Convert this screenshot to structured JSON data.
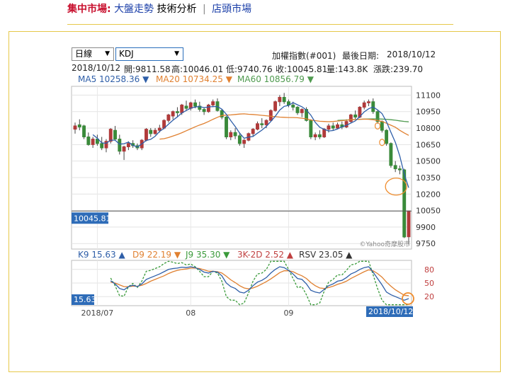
{
  "header": {
    "section": "集中市場:",
    "link1": "大盤走勢",
    "link2": "技術分析",
    "separator": "|",
    "link3": "店頭市場"
  },
  "controls": {
    "period": "日線",
    "indicator": "KDJ",
    "index_name": "加權指數(#001)",
    "last_date_label": "最後日期:",
    "last_date": "2018/10/12"
  },
  "quote": {
    "date": "2018/10/12",
    "open": "開:9811.58",
    "high": "高:10046.01",
    "low": "低:9740.76",
    "close": "收:10045.81",
    "volume": "量:143.8K",
    "change": "漲跌:239.70"
  },
  "ma_labels": {
    "ma5": "MA5 10258.36 ▼",
    "ma20": "MA20 10734.25 ▼",
    "ma60": "MA60 10856.79 ▼"
  },
  "kdj_labels": {
    "k": "K9 15.63 ▲",
    "d": "D9 22.19 ▼",
    "j": "J9 35.30 ▼",
    "diff": "3K-2D 2.52 ▲",
    "rsv": "RSV 23.05 ▲"
  },
  "colors": {
    "up": "#b03a3a",
    "down": "#3a8a3a",
    "ma5": "#2e5ea8",
    "ma20": "#e08030",
    "ma60": "#4f9a4f",
    "k": "#2e5ea8",
    "d": "#e08030",
    "j": "#3a9a3a",
    "badge": "#2e6cb8",
    "header_red": "#c8102e",
    "header_blue": "#1a3ea8",
    "highlight": "#f08c2c"
  },
  "chart_data": {
    "type": "candlestick",
    "price_axis": {
      "ticks": [
        11100,
        10950,
        10800,
        10650,
        10500,
        10350,
        10200,
        10050,
        9900,
        9750
      ],
      "range": [
        9700,
        11180
      ]
    },
    "kdj_axis": {
      "ticks": [
        80,
        50,
        20
      ],
      "range": [
        0,
        100
      ]
    },
    "x_ticks": [
      {
        "index": 5,
        "label": "2018/07"
      },
      {
        "index": 26,
        "label": "08"
      },
      {
        "index": 48,
        "label": "09"
      }
    ],
    "last_price_label": "10045.81",
    "last_k_label": "15.63",
    "last_date_label": "2018/10/12",
    "watermark": "©Yahoo奇摩股市",
    "ohlc": [
      [
        10790,
        10850,
        10750,
        10820
      ],
      [
        10830,
        10880,
        10780,
        10810
      ],
      [
        10820,
        10830,
        10700,
        10720
      ],
      [
        10720,
        10760,
        10640,
        10650
      ],
      [
        10650,
        10720,
        10620,
        10700
      ],
      [
        10700,
        10740,
        10640,
        10660
      ],
      [
        10660,
        10720,
        10600,
        10620
      ],
      [
        10620,
        10700,
        10580,
        10680
      ],
      [
        10680,
        10800,
        10660,
        10790
      ],
      [
        10780,
        10820,
        10690,
        10700
      ],
      [
        10700,
        10740,
        10560,
        10590
      ],
      [
        10590,
        10640,
        10510,
        10630
      ],
      [
        10630,
        10680,
        10600,
        10660
      ],
      [
        10660,
        10690,
        10620,
        10640
      ],
      [
        10640,
        10660,
        10600,
        10620
      ],
      [
        10620,
        10700,
        10600,
        10690
      ],
      [
        10690,
        10800,
        10680,
        10790
      ],
      [
        10780,
        10800,
        10720,
        10750
      ],
      [
        10750,
        10800,
        10740,
        10780
      ],
      [
        10780,
        10830,
        10760,
        10800
      ],
      [
        10800,
        10880,
        10790,
        10870
      ],
      [
        10870,
        10930,
        10850,
        10920
      ],
      [
        10910,
        10960,
        10880,
        10950
      ],
      [
        10950,
        10990,
        10900,
        10940
      ],
      [
        10940,
        11020,
        10920,
        11010
      ],
      [
        11000,
        11050,
        10960,
        10980
      ],
      [
        10980,
        11040,
        10960,
        11030
      ],
      [
        11030,
        11060,
        10980,
        11000
      ],
      [
        11000,
        11040,
        10950,
        10970
      ],
      [
        10970,
        10990,
        10920,
        10950
      ],
      [
        10950,
        11020,
        10940,
        11010
      ],
      [
        11010,
        11060,
        10990,
        11040
      ],
      [
        11040,
        11070,
        10950,
        10960
      ],
      [
        10960,
        10970,
        10880,
        10900
      ],
      [
        10900,
        10910,
        10700,
        10720
      ],
      [
        10720,
        10780,
        10690,
        10760
      ],
      [
        10760,
        10800,
        10700,
        10730
      ],
      [
        10730,
        10760,
        10640,
        10660
      ],
      [
        10660,
        10700,
        10620,
        10690
      ],
      [
        10690,
        10760,
        10680,
        10750
      ],
      [
        10750,
        10800,
        10720,
        10790
      ],
      [
        10790,
        10860,
        10780,
        10840
      ],
      [
        10840,
        10890,
        10800,
        10830
      ],
      [
        10830,
        10880,
        10800,
        10870
      ],
      [
        10870,
        10970,
        10860,
        10960
      ],
      [
        10960,
        11050,
        10950,
        11040
      ],
      [
        11040,
        11100,
        11000,
        11080
      ],
      [
        11080,
        11120,
        11020,
        11040
      ],
      [
        11040,
        11060,
        10990,
        11010
      ],
      [
        11010,
        11040,
        10960,
        10990
      ],
      [
        10990,
        11000,
        10920,
        10940
      ],
      [
        10940,
        10980,
        10900,
        10970
      ],
      [
        10970,
        10990,
        10860,
        10870
      ],
      [
        10870,
        10880,
        10700,
        10720
      ],
      [
        10720,
        10760,
        10690,
        10740
      ],
      [
        10740,
        10780,
        10700,
        10720
      ],
      [
        10720,
        10800,
        10710,
        10790
      ],
      [
        10790,
        10840,
        10760,
        10820
      ],
      [
        10820,
        10850,
        10780,
        10800
      ],
      [
        10800,
        10850,
        10790,
        10830
      ],
      [
        10830,
        10860,
        10790,
        10810
      ],
      [
        10810,
        10880,
        10800,
        10860
      ],
      [
        10860,
        10930,
        10850,
        10920
      ],
      [
        10920,
        10960,
        10880,
        10900
      ],
      [
        10900,
        11000,
        10890,
        10990
      ],
      [
        10990,
        11050,
        10970,
        11030
      ],
      [
        11030,
        11060,
        11000,
        11040
      ],
      [
        11040,
        11070,
        10930,
        10950
      ],
      [
        10950,
        10960,
        10840,
        10860
      ],
      [
        10860,
        10870,
        10760,
        10780
      ],
      [
        10780,
        10790,
        10640,
        10660
      ],
      [
        10660,
        10670,
        10440,
        10460
      ],
      [
        10460,
        10500,
        10400,
        10430
      ],
      [
        10430,
        10460,
        10380,
        10420
      ],
      [
        10420,
        10430,
        9800,
        9810
      ],
      [
        9811.58,
        10046.01,
        9740.76,
        10045.81
      ]
    ],
    "ma5": [
      null,
      null,
      null,
      null,
      10740,
      10708,
      10666,
      10662,
      10690,
      10690,
      10654,
      10658,
      10672,
      10644,
      10628,
      10656,
      10688,
      10698,
      10726,
      10770,
      10798,
      10836,
      10872,
      10902,
      10938,
      10960,
      10982,
      10992,
      10996,
      10986,
      10992,
      10996,
      10996,
      10972,
      10926,
      10868,
      10814,
      10754,
      10708,
      10718,
      10724,
      10754,
      10782,
      10816,
      10860,
      10908,
      10964,
      10998,
      11006,
      11032,
      11012,
      10994,
      10964,
      10918,
      10852,
      10808,
      10788,
      10774,
      10778,
      10792,
      10812,
      10826,
      10846,
      10866,
      10904,
      10948,
      10976,
      10992,
      10966,
      10932,
      10858,
      10762,
      10670,
      10546,
      10382,
      10258
    ],
    "ma20": [
      null,
      null,
      null,
      null,
      null,
      null,
      null,
      null,
      null,
      null,
      null,
      null,
      null,
      null,
      null,
      null,
      null,
      null,
      null,
      10700,
      10704,
      10714,
      10728,
      10742,
      10758,
      10776,
      10794,
      10812,
      10828,
      10842,
      10860,
      10880,
      10898,
      10914,
      10918,
      10920,
      10924,
      10928,
      10930,
      10926,
      10924,
      10920,
      10916,
      10912,
      10908,
      10904,
      10900,
      10898,
      10896,
      10896,
      10894,
      10890,
      10884,
      10874,
      10868,
      10862,
      10860,
      10858,
      10860,
      10864,
      10868,
      10872,
      10876,
      10878,
      10880,
      10882,
      10880,
      10876,
      10870,
      10860,
      10844,
      10826,
      10808,
      10780,
      10756,
      10734
    ],
    "ma60": [
      null,
      null,
      null,
      null,
      null,
      null,
      null,
      null,
      null,
      null,
      null,
      null,
      null,
      null,
      null,
      null,
      null,
      null,
      null,
      null,
      null,
      null,
      null,
      null,
      null,
      null,
      null,
      null,
      null,
      null,
      null,
      null,
      null,
      null,
      null,
      null,
      null,
      null,
      null,
      null,
      null,
      null,
      null,
      null,
      null,
      null,
      null,
      null,
      null,
      null,
      null,
      null,
      null,
      null,
      null,
      null,
      null,
      null,
      null,
      10870,
      10872,
      10874,
      10876,
      10878,
      10880,
      10882,
      10883,
      10884,
      10884,
      10882,
      10880,
      10876,
      10872,
      10866,
      10861,
      10857
    ],
    "k": [
      null,
      null,
      null,
      null,
      null,
      null,
      null,
      null,
      55,
      48,
      38,
      35,
      42,
      45,
      42,
      48,
      58,
      62,
      66,
      70,
      75,
      80,
      82,
      83,
      85,
      84,
      86,
      84,
      80,
      74,
      72,
      76,
      74,
      66,
      50,
      42,
      38,
      30,
      28,
      34,
      44,
      52,
      56,
      62,
      72,
      80,
      86,
      84,
      78,
      70,
      60,
      58,
      48,
      34,
      30,
      28,
      36,
      44,
      48,
      54,
      56,
      62,
      70,
      74,
      80,
      84,
      86,
      74,
      60,
      46,
      30,
      24,
      20,
      16,
      12,
      15.63
    ],
    "d": [
      null,
      null,
      null,
      null,
      null,
      null,
      null,
      null,
      52,
      50,
      46,
      42,
      42,
      43,
      43,
      45,
      49,
      54,
      58,
      62,
      66,
      71,
      75,
      78,
      80,
      81,
      83,
      83,
      82,
      79,
      76,
      76,
      75,
      72,
      65,
      57,
      51,
      44,
      39,
      37,
      39,
      43,
      48,
      53,
      59,
      66,
      73,
      77,
      77,
      75,
      70,
      66,
      60,
      51,
      44,
      39,
      38,
      40,
      43,
      47,
      50,
      54,
      60,
      65,
      70,
      75,
      79,
      77,
      71,
      63,
      52,
      43,
      35,
      29,
      23,
      22.19
    ]
  }
}
